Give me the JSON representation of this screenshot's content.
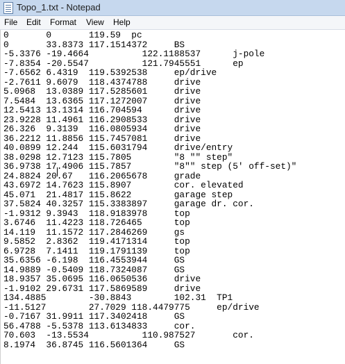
{
  "window": {
    "title": "Topo_1.txt - Notepad",
    "icon": "notepad-icon"
  },
  "menu": [
    "File",
    "Edit",
    "Format",
    "View",
    "Help"
  ],
  "editor": {
    "lines": [
      "0       0       119.59  pc",
      "0       33.8373 117.1514372     BS",
      "-5.3376 -19.4664          122.1188537      j-pole",
      "-7.8354 -20.5547          121.7945551      ep",
      "-7.6562 6.4319  119.5392538     ep/drive",
      "-2.7611 9.6079  118.4374788     drive",
      "5.0968  13.0389 117.5285601     drive",
      "7.5484  13.6365 117.1272007     drive",
      "12.5413 13.1314 116.704594      drive",
      "23.9228 11.4961 116.2908533     drive",
      "26.326  9.3139  116.0805934     drive",
      "36.2212 11.8856 115.7457081     drive",
      "40.0899 12.244  115.6031794     drive/entry",
      "38.0298 12.7123 115.7805        \"8 \"\" step\"",
      "36.9738 17.4906 115.7857        \"8\"\" step (5' off-set)\"",
      "24.8824 20.67   116.2065678     grade",
      "43.6972 14.7623 115.8907        cor. elevated",
      "45.071  21.4817 115.8622        garage step",
      "37.5824 40.3257 115.3383897     garage dr. cor.",
      "-1.9312 9.3943  118.9183978     top",
      "3.6746  11.4223 118.726465      top",
      "14.119  11.1572 117.2846269     gs",
      "9.5852  2.8362  119.4171314     top",
      "6.9728  7.1411  119.1791139     top",
      "35.6356 -6.198  116.4553944     GS",
      "14.9889 -0.5409 118.7324087     GS",
      "18.9357 35.0695 116.0650536     drive",
      "-1.9102 29.6731 117.5869589     drive",
      "134.4885        -30.8843        102.31  TP1",
      "-11.5127        27.7029 118.4479775     ep/drive",
      "-0.7167 31.9911 117.3402418     GS",
      "56.4788 -5.5378 113.6134833     cor.",
      "70.603  -13.5534          110.987527       cor.",
      "8.1974  36.8745 116.5601364     GS"
    ]
  }
}
